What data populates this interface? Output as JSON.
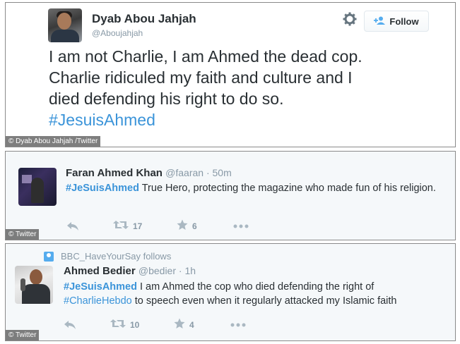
{
  "tweet_main": {
    "name": "Dyab Abou Jahjah",
    "handle": "@Aboujahjah",
    "follow_label": "Follow",
    "line1": "I am not Charlie, I am Ahmed the dead cop.",
    "line2": "Charlie ridiculed my faith and culture and I",
    "line3": "died defending his right to do so.",
    "hashtag": "#JesuisAhmed",
    "credit": "© Dyab Abou Jahjah /Twitter"
  },
  "tweet_second": {
    "name": "Faran Ahmed Khan",
    "meta": "@faaran · 50m",
    "hashtag": "#JeSuisAhmed",
    "text": " True Hero, protecting the magazine who made fun of his religion.",
    "retweets": "17",
    "favorites": "6",
    "credit": "© Twitter"
  },
  "tweet_third": {
    "follows_label": "BBC_HaveYourSay follows",
    "name": "Ahmed Bedier",
    "meta": "@bedier · 1h",
    "hashtag": "#JeSuisAhmed",
    "text_part1": " I am Ahmed the cop who died defending the right of",
    "hashtag2": "#CharlieHebdo",
    "text_part2": " to speech even when it regularly attacked my Islamic faith",
    "retweets": "10",
    "favorites": "4",
    "credit": "© Twitter"
  },
  "icons": {
    "settings": "gear-icon",
    "follow": "add-user-icon",
    "reply": "reply-icon",
    "retweet": "retweet-icon",
    "favorite": "star-icon",
    "more": "more-icon",
    "follows_badge": "user-badge-icon"
  },
  "colors": {
    "hashtag": "#3b94d9",
    "muted": "#8899a6",
    "text": "#292f33",
    "action_icons": "#aab8c2"
  }
}
